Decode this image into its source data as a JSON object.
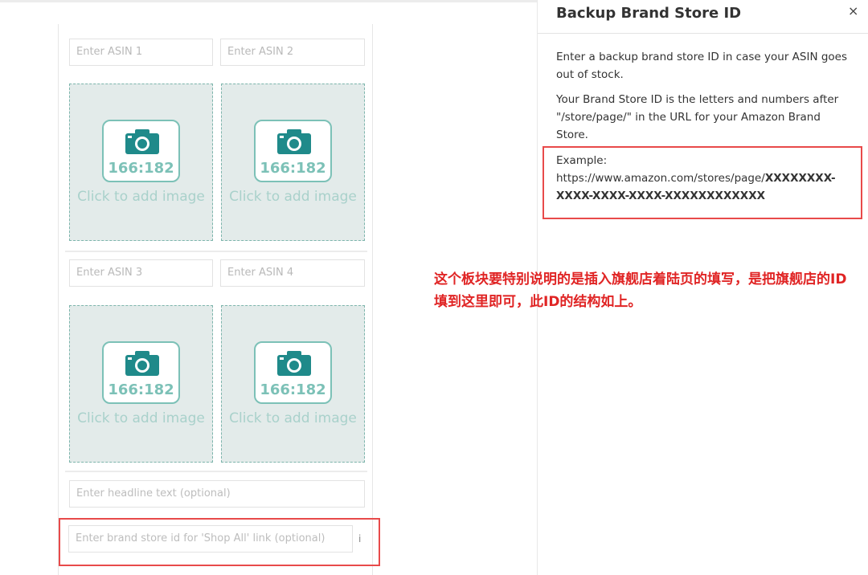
{
  "editor": {
    "asin_placeholders": [
      "Enter ASIN 1",
      "Enter ASIN 2",
      "Enter ASIN 3",
      "Enter ASIN 4"
    ],
    "image_ratio": "166:182",
    "add_image_label": "Click to add image",
    "headline_placeholder": "Enter headline text (optional)",
    "store_id_placeholder": "Enter brand store id for 'Shop All' link (optional)"
  },
  "panel": {
    "title": "Backup Brand Store ID",
    "close_symbol": "×",
    "intro": "Enter a backup brand store ID in case your ASIN goes out of stock.",
    "explain": "Your Brand Store ID is the letters and numbers after \"/store/page/\" in the URL for your Amazon Brand Store.",
    "example_label": "Example:",
    "example_url_prefix": "https://www.amazon.com/stores/page/",
    "example_url_id": "XXXXXXXX-XXXX-XXXX-XXXX-XXXXXXXXXXXX"
  },
  "annotation": {
    "text": "这个板块要特别说明的是插入旗舰店着陆页的填写，是把旗舰店的ID填到这里即可，此ID的结构如上。",
    "color": "#e02424"
  },
  "colors": {
    "accent_teal": "#7cc1b7",
    "camera_teal": "#1f8a8a",
    "highlight_red": "#e84a4a"
  },
  "icons": {
    "camera": "camera-icon",
    "close": "close-icon"
  }
}
